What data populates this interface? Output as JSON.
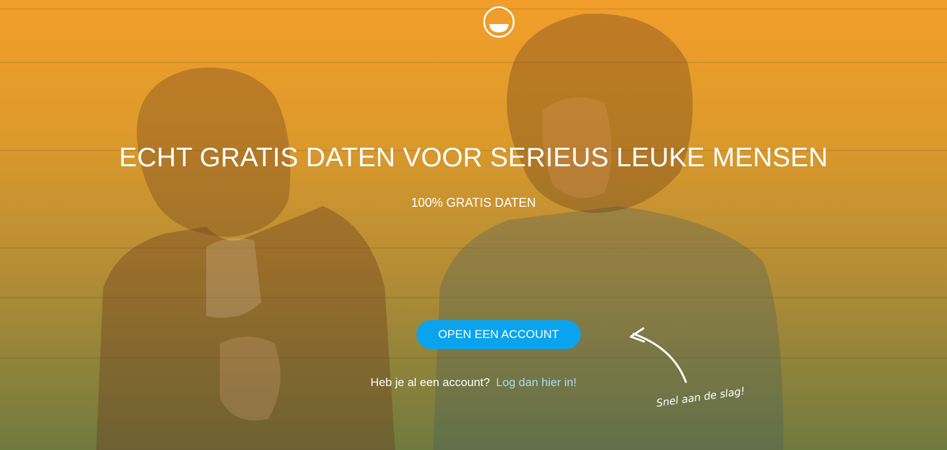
{
  "logo": {
    "icon": "smiley-logo-icon"
  },
  "hero": {
    "title": "ECHT GRATIS DATEN VOOR SERIEUS LEUKE MENSEN",
    "subtitle": "100% GRATIS DATEN",
    "cta_label": "OPEN EEN ACCOUNT",
    "login_prompt": "Heb je al een account?",
    "login_link": "Log dan hier in!",
    "hint": "Snel aan de slag!"
  },
  "colors": {
    "gradient_top": "#f29e2a",
    "gradient_bottom": "#6f7a3f",
    "cta_background": "#0aa4ee",
    "link": "#a9dcf5",
    "text": "#ffffff"
  }
}
